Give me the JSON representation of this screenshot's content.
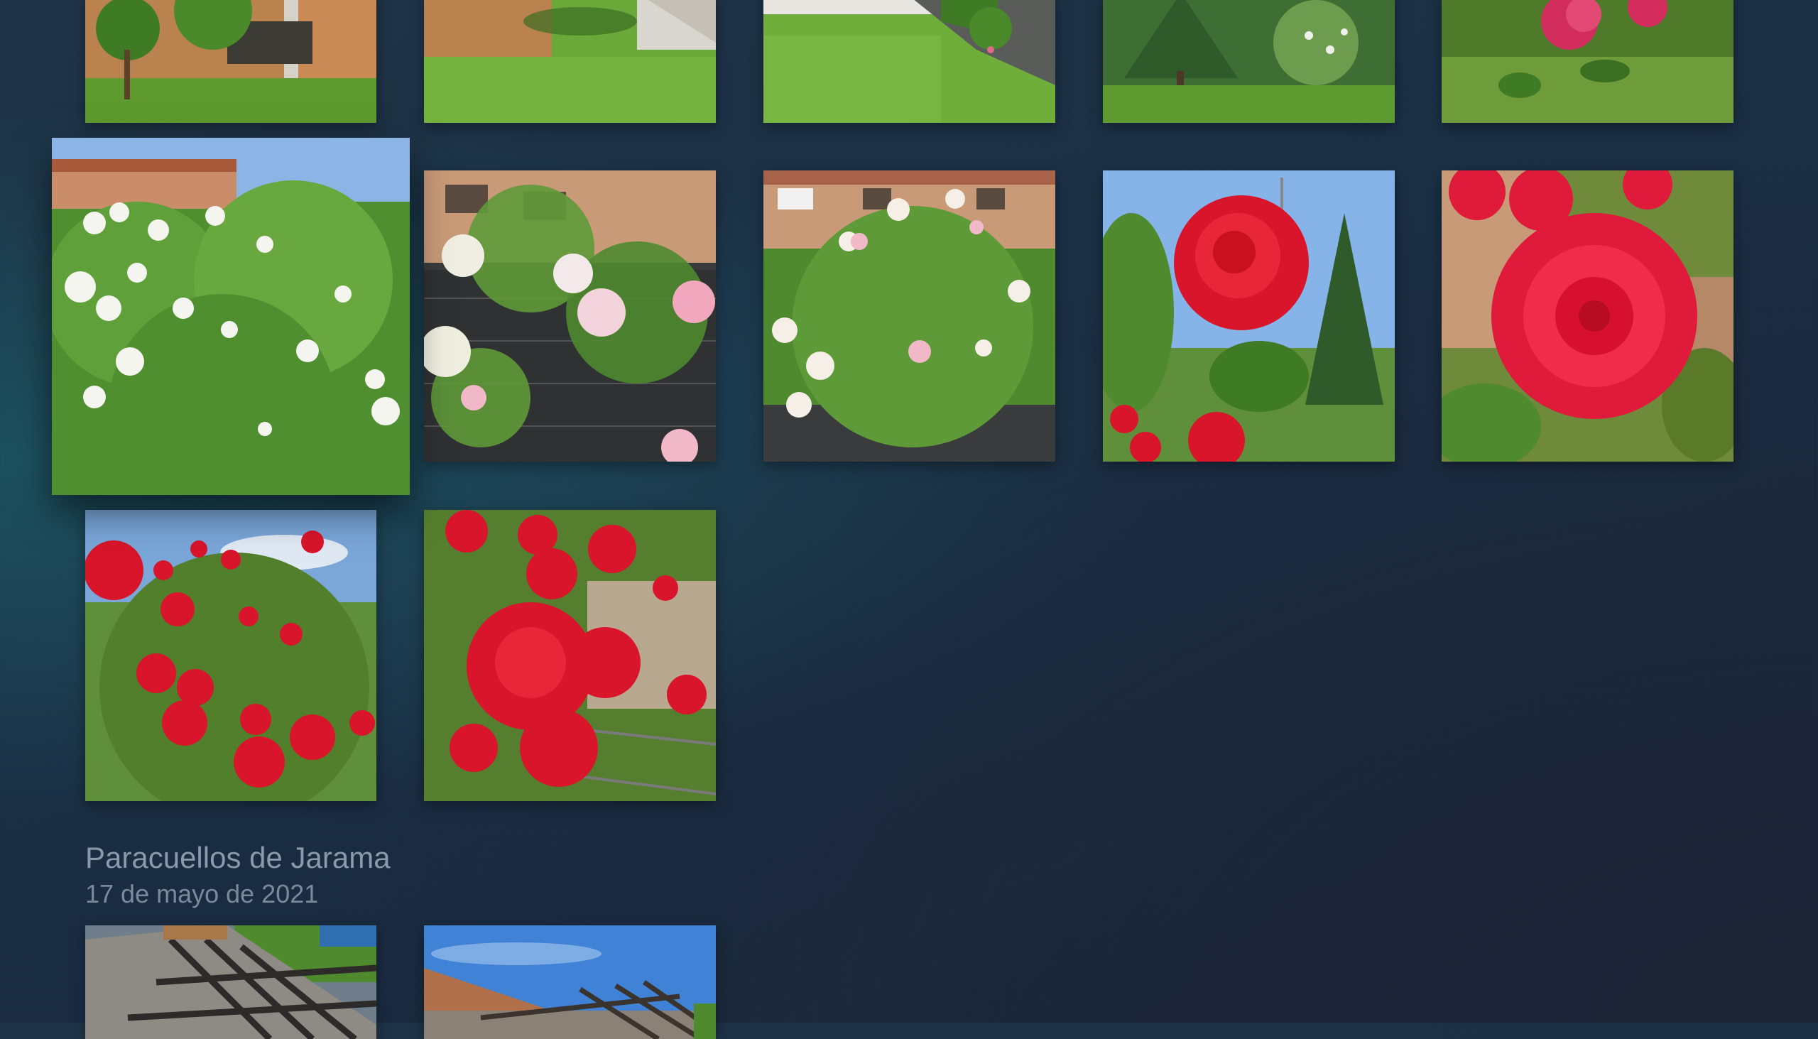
{
  "library": {
    "sections": [
      {
        "id": "prev-section",
        "photos": [
          {
            "subject": "garden-patio-tree",
            "scene": "lawn"
          },
          {
            "subject": "garden-lawn-path",
            "scene": "lawn"
          },
          {
            "subject": "garden-lawn-fence",
            "scene": "lawn"
          },
          {
            "subject": "garden-conifer",
            "scene": "lawn"
          },
          {
            "subject": "pink-roses-lawn",
            "scene": "lawn"
          },
          {
            "subject": "white-roses-bush",
            "scene": "white-roses",
            "focused": true
          },
          {
            "subject": "pink-white-roses-fence",
            "scene": "pink-roses"
          },
          {
            "subject": "climbing-roses-houses",
            "scene": "pink-roses"
          },
          {
            "subject": "red-rose-sky",
            "scene": "red-rose"
          },
          {
            "subject": "red-rose-closeup",
            "scene": "red-rose"
          },
          {
            "subject": "red-roses-bush-sky",
            "scene": "red-roses"
          },
          {
            "subject": "red-roses-cluster",
            "scene": "red-roses"
          }
        ]
      },
      {
        "id": "paracuellos",
        "title": "Paracuellos de Jarama",
        "date": "17 de mayo de 2021",
        "photos": [
          {
            "subject": "pergola-roof",
            "scene": "pergola"
          },
          {
            "subject": "pergola-sky",
            "scene": "pergola-sky"
          }
        ]
      }
    ]
  }
}
